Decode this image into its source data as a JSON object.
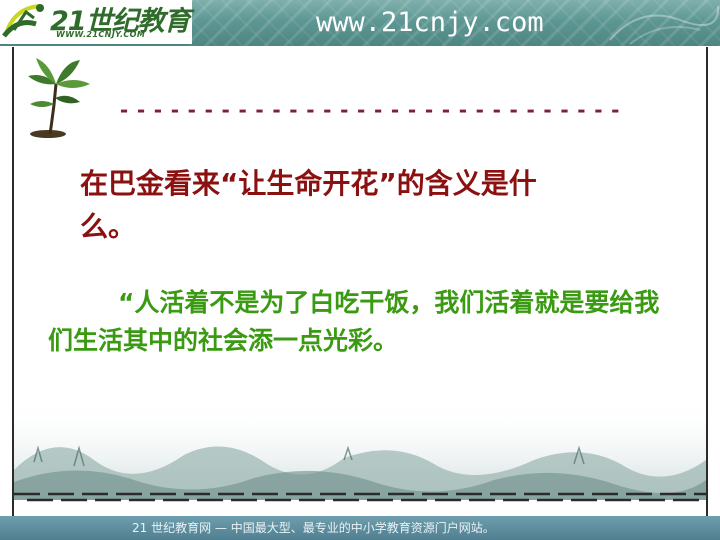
{
  "header": {
    "logo_text": "21世纪教育",
    "logo_subtext": "WWW.21CNJY.COM",
    "site_url": "www.21cnjy.com"
  },
  "slide": {
    "divider": "------------------------------",
    "question": "在巴金看来“让生命开花”的含义是什么。",
    "quote": "“人活着不是为了白吃干饭，我们活着就是要给我们生活其中的社会添一点光彩。"
  },
  "footer": {
    "text": "21 世纪教育网 — 中国最大型、最专业的中小学教育资源门户网站。"
  },
  "colors": {
    "header_teal": "#5d9793",
    "question_red": "#8b1010",
    "quote_green": "#3a9a12",
    "divider_maroon": "#7b1f3b"
  },
  "icons": [
    "logo-runner-icon",
    "plant-icon"
  ]
}
